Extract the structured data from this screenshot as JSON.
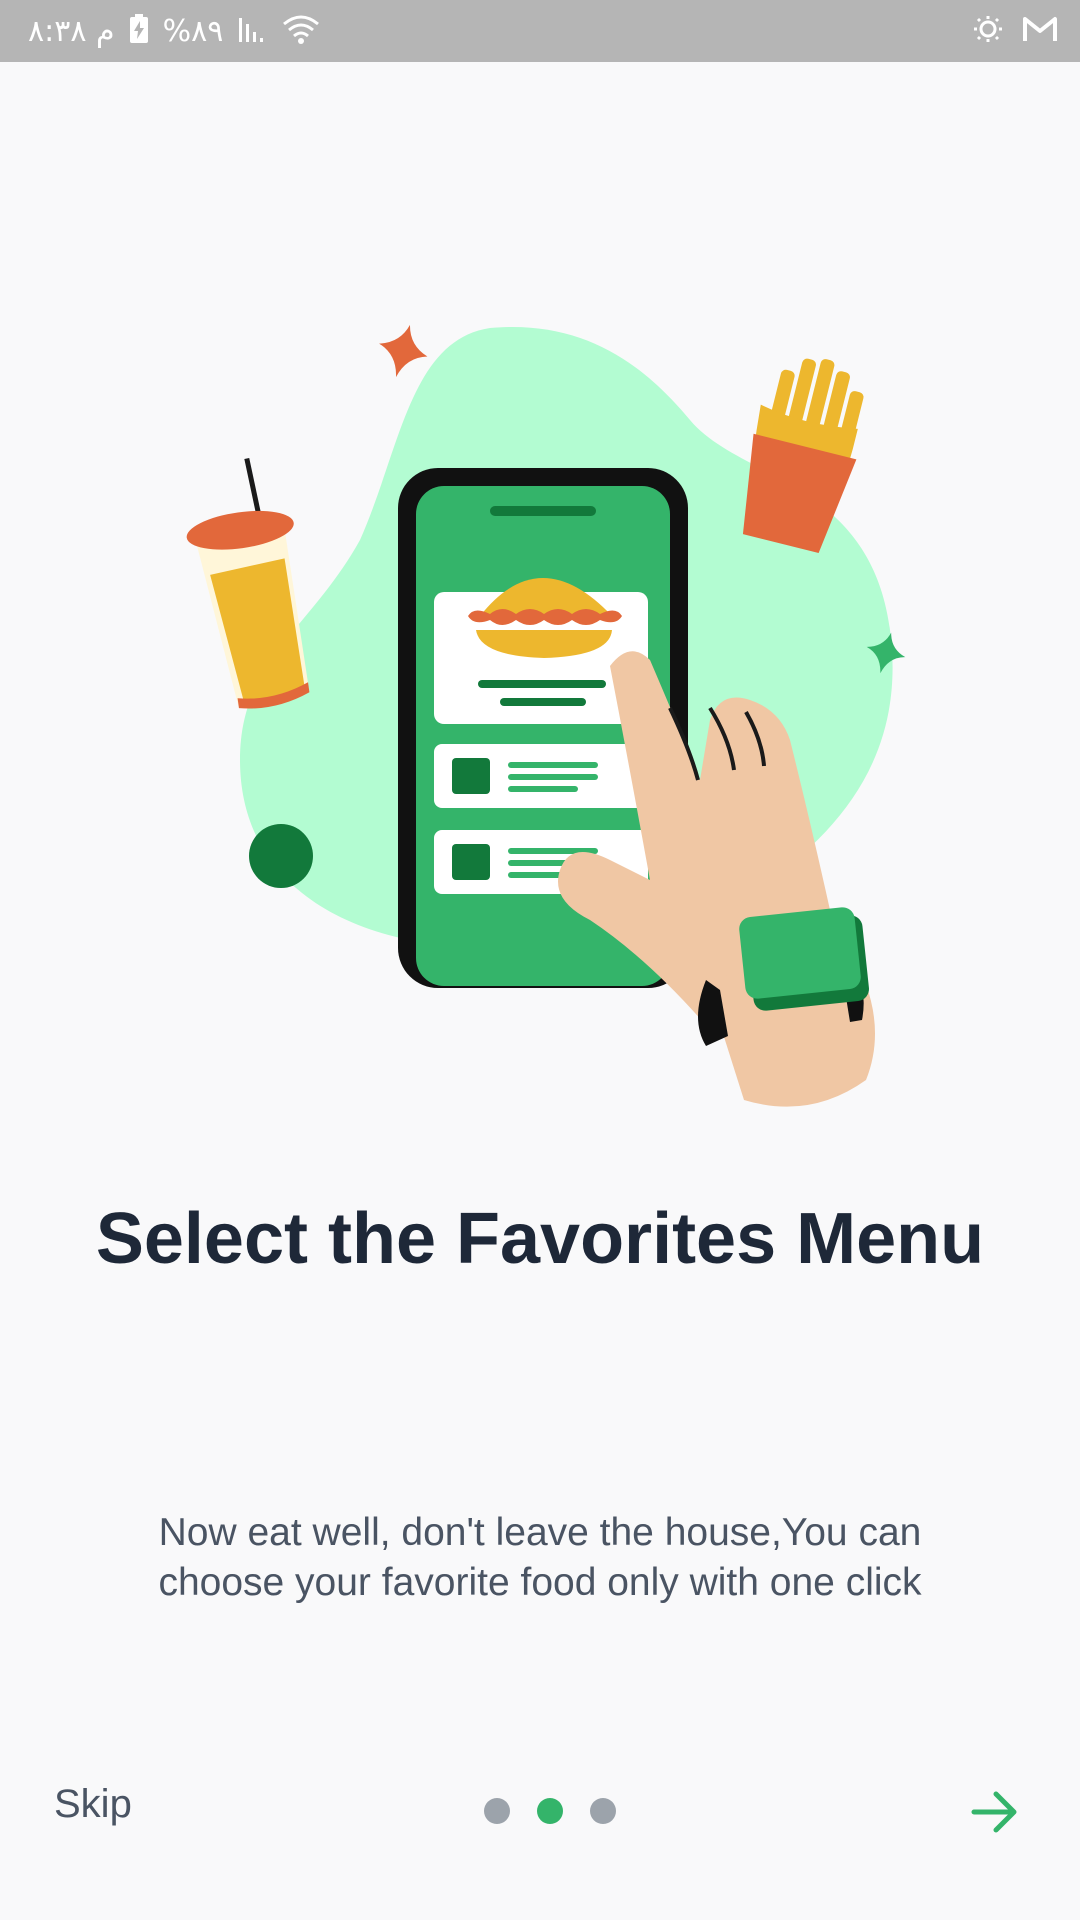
{
  "status_bar": {
    "time": "م ٨:٣٨",
    "battery": "%٨٩",
    "icons": [
      "battery-charging-icon",
      "signal-icon",
      "wifi-icon",
      "eye-comfort-icon",
      "gmail-icon"
    ]
  },
  "onboarding": {
    "title": "Select the Favorites Menu",
    "description": "Now eat well, don't leave the house,You can choose your favorite food only with one click",
    "skip_label": "Skip",
    "page_count": 3,
    "active_page": 2,
    "next_icon": "arrow-right-icon"
  },
  "colors": {
    "accent": "#34b46a",
    "title": "#1e2838",
    "body_text": "#4a5463",
    "inactive_dot": "#9ca3ab",
    "status_bar": "#b5b5b5",
    "blob": "#b3fcd2",
    "dark_green": "#12793b",
    "orange": "#e2683b",
    "yellow": "#edb72e",
    "skin": "#f0c7a4"
  }
}
